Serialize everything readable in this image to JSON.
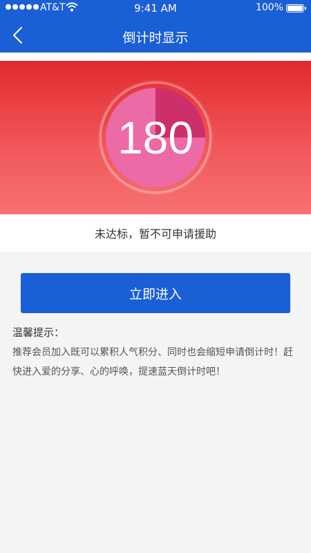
{
  "status_bar": {
    "carrier": "AT&T",
    "time": "9:41 AM",
    "battery": "100%"
  },
  "nav": {
    "title": "倒计时显示"
  },
  "countdown": {
    "value": "180",
    "ring_color": "#cc2f6a",
    "fill_color": "#ec6aa6"
  },
  "status_message": "未达标，暂不可申请援助",
  "enter_button": "立即进入",
  "tips": {
    "title": "温馨提示：",
    "body": "推荐会员加入既可以累积人气积分、同时也会缩短申请倒计时！赶快进入爱的分享、心的呼唤，提速蓝天倒计时吧！"
  },
  "colors": {
    "primary": "#1a5fd6",
    "hero_top": "#e22a2f",
    "hero_bottom": "#f87171"
  }
}
